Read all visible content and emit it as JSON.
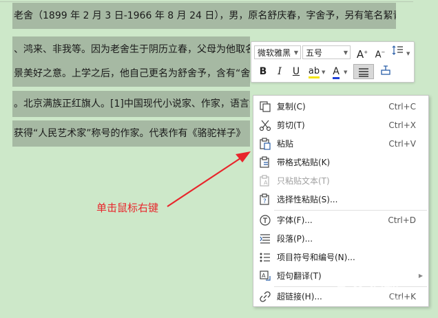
{
  "document": {
    "lines": [
      "老舍（1899 年 2 月 3 日-1966 年 8 月 24 日），男，原名舒庆春，字舍予，另有笔名絜青",
      "、鸿来、非我等。因为老舍生于阴历立春，父母为他取名",
      "景美好之意。上学之后，他自己更名为舒舍予，含有“舍",
      "。北京满族正红旗人。[1]中国现代小说家、作家，语言大",
      "获得“人民艺术家”称号的作家。代表作有《骆驼祥子》"
    ]
  },
  "mini_toolbar": {
    "font_name": "微软雅黑",
    "font_size": "五号",
    "grow_font": "A",
    "shrink_font": "A",
    "bold": "B",
    "italic": "I",
    "underline": "U",
    "highlight": "ab",
    "font_color": "A"
  },
  "context_menu": {
    "items": [
      {
        "label": "复制(C)",
        "shortcut": "Ctrl+C",
        "icon": "copy-icon"
      },
      {
        "label": "剪切(T)",
        "shortcut": "Ctrl+X",
        "icon": "scissors-icon"
      },
      {
        "label": "粘贴",
        "shortcut": "Ctrl+V",
        "icon": "paste-icon"
      },
      {
        "label": "带格式粘贴(K)",
        "shortcut": "",
        "icon": "paste-format-icon"
      },
      {
        "label": "只粘贴文本(T)",
        "shortcut": "",
        "icon": "paste-text-icon",
        "disabled": true
      },
      {
        "label": "选择性粘贴(S)...",
        "shortcut": "",
        "icon": "paste-special-icon"
      },
      {
        "label": "字体(F)...",
        "shortcut": "Ctrl+D",
        "icon": "font-icon"
      },
      {
        "label": "段落(P)...",
        "shortcut": "",
        "icon": "paragraph-icon"
      },
      {
        "label": "项目符号和编号(N)...",
        "shortcut": "",
        "icon": "bullets-icon"
      },
      {
        "label": "短句翻译(T)",
        "shortcut": "",
        "icon": "translate-icon",
        "submenu": true
      },
      {
        "label": "超链接(H)...",
        "shortcut": "Ctrl+K",
        "icon": "hyperlink-icon"
      }
    ]
  },
  "annotation": {
    "text": "单击鼠标右键",
    "color": "#e8262c"
  },
  "watermark": {
    "text": "Bai 经验",
    "sub": "jingyan.baidu.com"
  }
}
